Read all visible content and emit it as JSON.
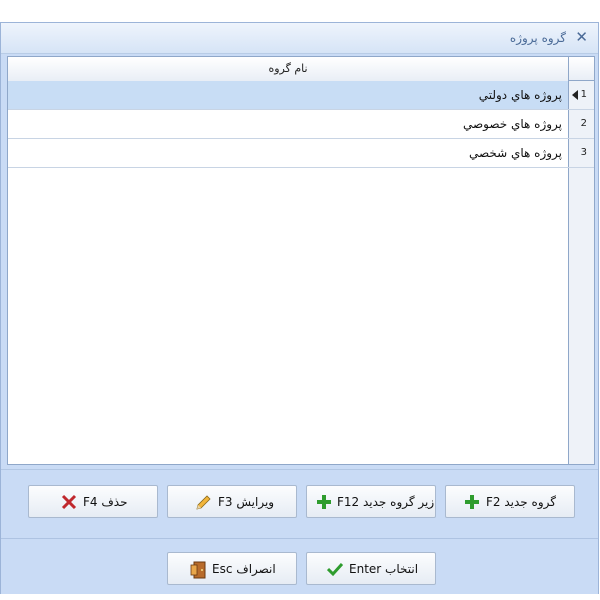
{
  "window": {
    "title": "گروه پروژه",
    "close_icon": "close-icon"
  },
  "grid": {
    "column_header": "نام گروه",
    "rows": [
      {
        "index": "1",
        "name": "پروژه هاي دولتي",
        "selected": true
      },
      {
        "index": "2",
        "name": "پروژه هاي خصوصي",
        "selected": false
      },
      {
        "index": "3",
        "name": "پروژه هاي شخصي",
        "selected": false
      }
    ]
  },
  "buttons": {
    "new_group": "گروه جديد F2",
    "new_subgroup": "زير گروه جديد F12",
    "edit": "ويرايش F3",
    "delete": "حذف F4",
    "select": "انتخاب Enter",
    "cancel": "انصراف Esc"
  },
  "colors": {
    "selected_row": "#c8ddf5",
    "panel_bg": "#c9dbf5",
    "plus_green": "#2e9c2e",
    "delete_red": "#c0282d"
  }
}
